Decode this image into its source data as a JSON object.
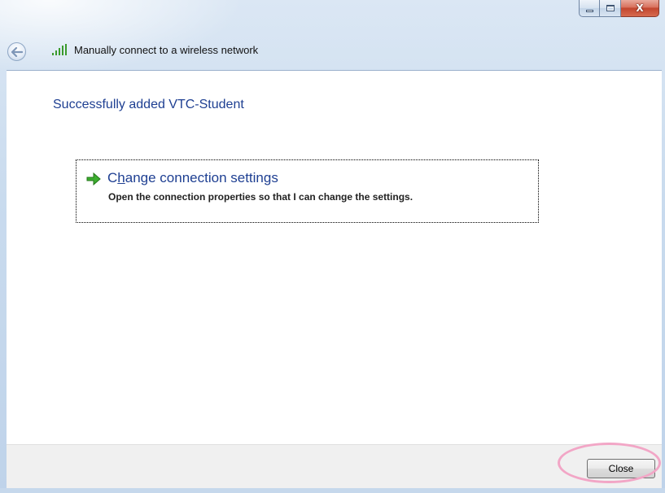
{
  "window": {
    "title": "Manually connect to a wireless network",
    "close_glyph": "X"
  },
  "icons": {
    "back": "back-arrow-icon",
    "network": "wireless-signal-icon",
    "option": "green-arrow-icon"
  },
  "content": {
    "heading": "Successfully added VTC-Student",
    "option": {
      "title_before": "C",
      "title_underlined": "h",
      "title_after": "ange connection settings",
      "description": "Open the connection properties so that I can change the settings."
    }
  },
  "footer": {
    "close_label": "Close"
  },
  "colors": {
    "heading": "#1e3f92",
    "highlight": "#f2a6c6"
  }
}
